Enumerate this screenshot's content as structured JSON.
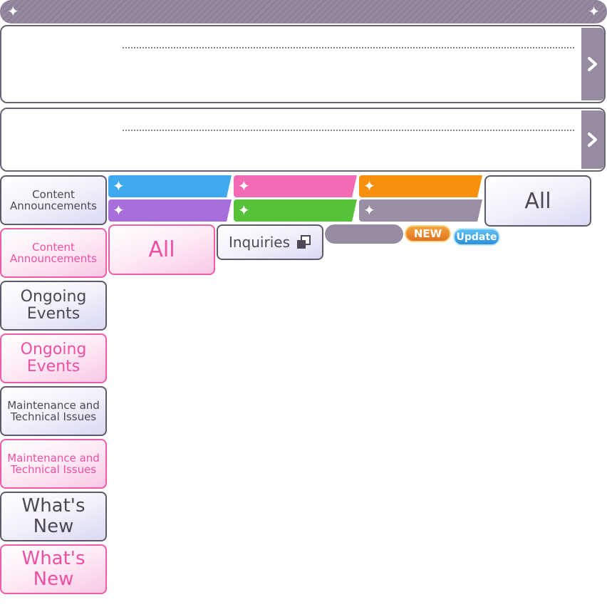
{
  "header": {
    "left_icon": "sparkle-icon",
    "right_icon": "sparkle-icon"
  },
  "notice_cards": [
    {
      "arrow_icon": "chevron-right-icon"
    },
    {
      "arrow_icon": "chevron-right-icon"
    }
  ],
  "category_bars": [
    {
      "color": "#3fa9f0",
      "icon": "sparkle-icon"
    },
    {
      "color": "#f26bb5",
      "icon": "sparkle-icon"
    },
    {
      "color": "#f7900f",
      "icon": "sparkle-icon"
    },
    {
      "color": "#a86fdc",
      "icon": "sparkle-icon"
    },
    {
      "color": "#55c23a",
      "icon": "sparkle-icon"
    },
    {
      "color": "#9a8ea5",
      "icon": "sparkle-icon"
    }
  ],
  "buttons": {
    "all_gray": "All",
    "all_pink": "All",
    "inquiries": "Inquiries",
    "inquiries_icon": "external-window-icon"
  },
  "badges": {
    "new": "NEW",
    "update": "Update"
  },
  "tabs": [
    {
      "label": "Content\nAnnouncements",
      "style": "gray"
    },
    {
      "label": "Content\nAnnouncements",
      "style": "pink"
    },
    {
      "label": "Ongoing\nEvents",
      "style": "gray"
    },
    {
      "label": "Ongoing\nEvents",
      "style": "pink"
    },
    {
      "label": "Maintenance and\nTechnical Issues",
      "style": "gray"
    },
    {
      "label": "Maintenance and\nTechnical Issues",
      "style": "pink"
    },
    {
      "label": "What's\nNew",
      "style": "gray"
    },
    {
      "label": "What's\nNew",
      "style": "pink"
    }
  ],
  "colors": {
    "gray_border": "#5f5868",
    "pink": "#ef5da8",
    "header": "#918599"
  }
}
